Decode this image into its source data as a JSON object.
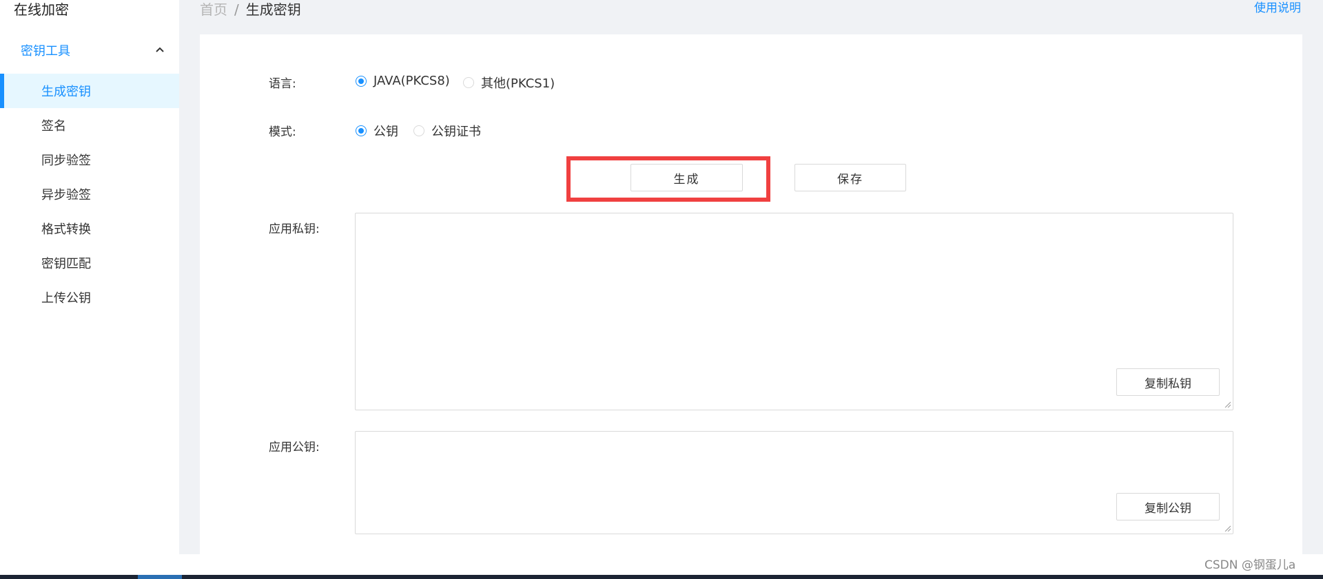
{
  "app": {
    "title": "在线加密"
  },
  "sidebar": {
    "group": {
      "label": "密钥工具",
      "icon": "chevron-up-icon"
    },
    "items": [
      {
        "label": "生成密钥",
        "active": true
      },
      {
        "label": "签名"
      },
      {
        "label": "同步验签"
      },
      {
        "label": "异步验签"
      },
      {
        "label": "格式转换"
      },
      {
        "label": "密钥匹配"
      },
      {
        "label": "上传公钥"
      }
    ]
  },
  "breadcrumb": {
    "home": "首页",
    "separator": "/",
    "current": "生成密钥"
  },
  "header": {
    "help_link": "使用说明"
  },
  "form": {
    "language": {
      "label": "语言:",
      "options": [
        {
          "label": "JAVA(PKCS8)",
          "checked": true
        },
        {
          "label": "其他(PKCS1)",
          "checked": false
        }
      ]
    },
    "mode": {
      "label": "模式:",
      "options": [
        {
          "label": "公钥",
          "checked": true
        },
        {
          "label": "公钥证书",
          "checked": false
        }
      ]
    },
    "buttons": {
      "generate": "生成",
      "save": "保存"
    },
    "private_key": {
      "label": "应用私钥:",
      "value": "",
      "copy_button": "复制私钥"
    },
    "public_key": {
      "label": "应用公钥:",
      "value": "",
      "copy_button": "复制公钥"
    }
  },
  "footer": {
    "watermark": "CSDN @钢蛋儿a"
  },
  "colors": {
    "accent": "#1890ff",
    "highlight": "#f04040",
    "active_bg": "#e6f7ff",
    "main_bg": "#f0f2f5"
  }
}
